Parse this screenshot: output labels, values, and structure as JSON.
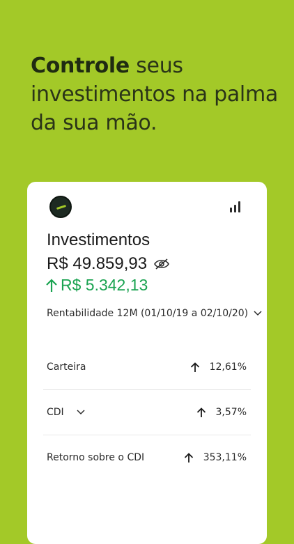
{
  "headline": {
    "bold": "Controle",
    "rest": " seus investimentos na palma da sua mão."
  },
  "card": {
    "title": "Investimentos",
    "balance": "R$ 49.859,93",
    "gain": "R$ 5.342,13",
    "period_label": "Rentabilidade 12M (01/10/19 a 02/10/20)",
    "rows": [
      {
        "label": "Carteira",
        "value": "12,61%"
      },
      {
        "label": "CDI",
        "value": "3,57%"
      },
      {
        "label": "Retorno sobre o CDI",
        "value": "353,11%"
      }
    ]
  },
  "colors": {
    "background": "#a3c928",
    "gain_green": "#1aa351",
    "card": "#ffffff"
  },
  "icons": [
    "logo-icon",
    "bar-chart-icon",
    "eye-slash-icon",
    "arrow-up-icon",
    "chevron-down-icon"
  ]
}
